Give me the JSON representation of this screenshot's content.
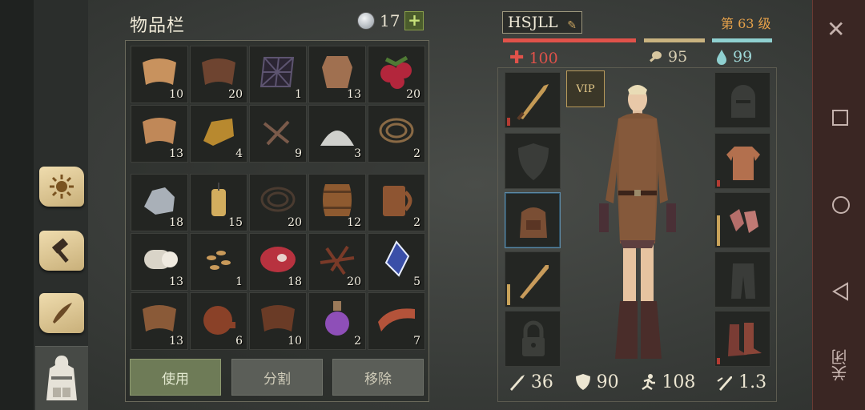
{
  "inventory": {
    "title": "物品栏",
    "gems": "17",
    "add_label": "+",
    "top_items": [
      {
        "icon": "cloth-icon",
        "qty": "10",
        "color": "#c8925e"
      },
      {
        "icon": "leather-icon",
        "qty": "20",
        "color": "#6e4430"
      },
      {
        "icon": "rope-net-icon",
        "qty": "1",
        "color": "#5d5470"
      },
      {
        "icon": "animal-hide-icon",
        "qty": "13",
        "color": "#a07050"
      },
      {
        "icon": "berries-icon",
        "qty": "20",
        "color": "#b3263c"
      },
      {
        "icon": "woven-cloth-icon",
        "qty": "13",
        "color": "#c08858"
      },
      {
        "icon": "gold-ingot-icon",
        "qty": "4",
        "color": "#b8892f"
      },
      {
        "icon": "nails-icon",
        "qty": "9",
        "color": "#7a5a4a"
      },
      {
        "icon": "salt-pile-icon",
        "qty": "3",
        "color": "#cfd0cc"
      },
      {
        "icon": "rope-icon",
        "qty": "2",
        "color": "#8a6a45"
      }
    ],
    "bottom_items": [
      {
        "icon": "iron-ore-icon",
        "qty": "18",
        "color": "#a9b0b8"
      },
      {
        "icon": "candle-icon",
        "qty": "15",
        "color": "#d2ad5e"
      },
      {
        "icon": "cord-coil-icon",
        "qty": "20",
        "color": "#4a3b30"
      },
      {
        "icon": "barrel-icon",
        "qty": "12",
        "color": "#8e5a30"
      },
      {
        "icon": "mug-icon",
        "qty": "2",
        "color": "#8e5532"
      },
      {
        "icon": "linen-roll-icon",
        "qty": "13",
        "color": "#d9d4c8"
      },
      {
        "icon": "seeds-icon",
        "qty": "1",
        "color": "#c99a5a"
      },
      {
        "icon": "raw-meat-icon",
        "qty": "18",
        "color": "#b8323f"
      },
      {
        "icon": "twigs-icon",
        "qty": "20",
        "color": "#7a3a28"
      },
      {
        "icon": "crystal-icon",
        "qty": "5",
        "color": "#3a4fa8"
      },
      {
        "icon": "leather-scrap-icon",
        "qty": "13",
        "color": "#8a5a38"
      },
      {
        "icon": "waterskin-icon",
        "qty": "6",
        "color": "#8a4128"
      },
      {
        "icon": "leather-strap-icon",
        "qty": "10",
        "color": "#6a3b26"
      },
      {
        "icon": "potion-icon",
        "qty": "2",
        "color": "#8e4fb8"
      },
      {
        "icon": "bacon-icon",
        "qty": "7",
        "color": "#b4533a"
      }
    ],
    "buttons": {
      "use": "使用",
      "split": "分割",
      "remove": "移除"
    }
  },
  "character": {
    "name": "HSJLL",
    "level": "第 63 级",
    "health": "100",
    "food": "95",
    "water": "99",
    "vip": "VIP",
    "stats": {
      "attack": "36",
      "armor": "90",
      "speed": "108",
      "attack_speed": "1.3"
    },
    "colors": {
      "health": "#e0524a",
      "food": "#c9b380",
      "water": "#8fd0d0"
    }
  },
  "system": {
    "close_label": "关闭"
  }
}
